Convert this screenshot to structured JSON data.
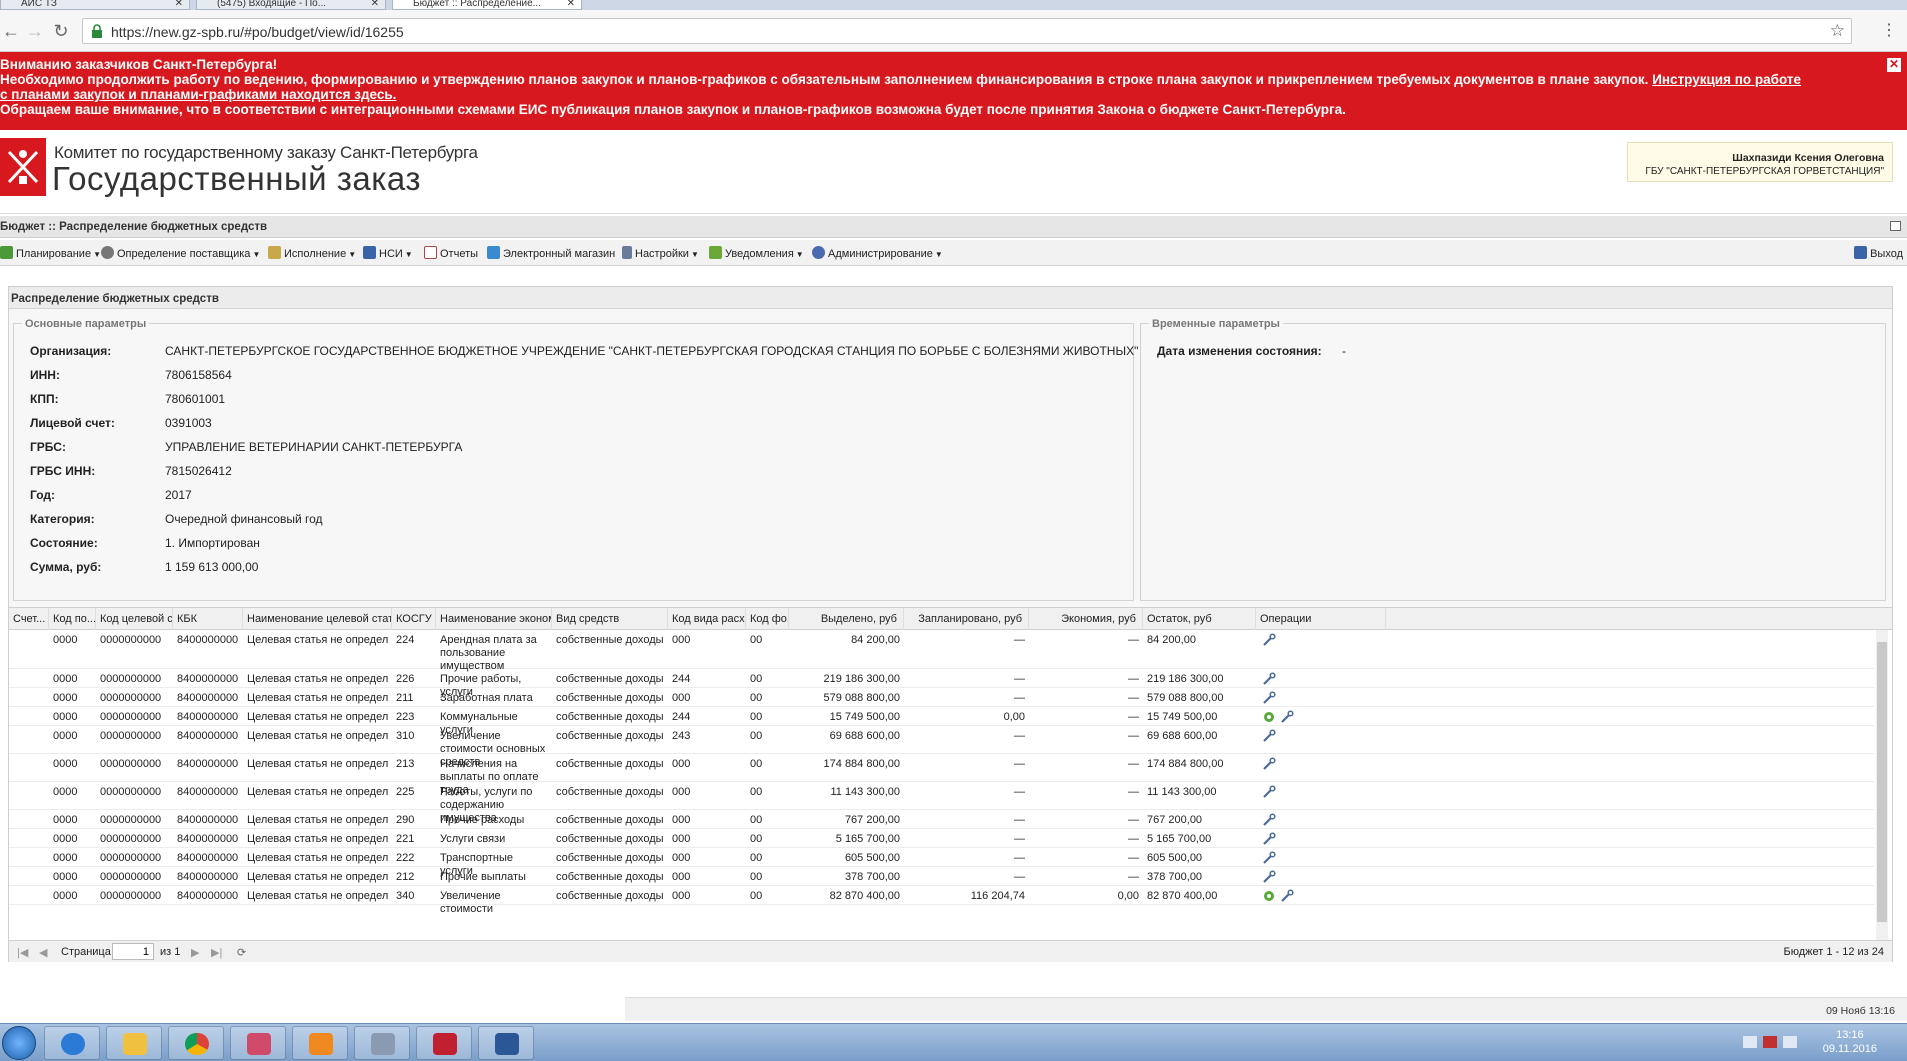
{
  "browser": {
    "tabs": [
      {
        "label": "АИС ТЗ",
        "active": false
      },
      {
        "label": "(5475) Входящие - По...",
        "active": false
      },
      {
        "label": "Бюджет :: Распределение...",
        "active": true
      }
    ],
    "url": "https://new.gz-spb.ru/#po/budget/view/id/16255"
  },
  "banner": {
    "line1": "Вниманию заказчиков Санкт-Петербурга!",
    "line2": "Необходимо продолжить работу по ведению, формированию и утверждению планов закупок и планов-графиков с обязательным заполнением финансирования в строке плана закупок и прикреплением требуемых документов в плане закупок.",
    "link_part1": "Инструкция по работе",
    "link_part2": "с планами закупок и планами-графиками находится здесь.",
    "line3": "Обращаем ваше внимание, что в соответствии с интеграционными схемами ЕИС публикация планов закупок и планов-графиков возможна будет после принятия Закона о бюджете Санкт-Петербурга.",
    "close": "✕"
  },
  "header": {
    "org_line": "Комитет по государственному заказу Санкт-Петербурга",
    "org_big": "Государственный заказ",
    "user_name": "Шахпазиди Ксения Олеговна",
    "user_org": "ГБУ \"САНКТ-ПЕТЕРБУРГСКАЯ ГОРВЕТСТАНЦИЯ\""
  },
  "breadcrumb": "Бюджет :: Распределение бюджетных средств",
  "menu": {
    "items": [
      {
        "label": "Планирование",
        "color": "#4a9a3a"
      },
      {
        "label": "Определение поставщика",
        "color": "#777777"
      },
      {
        "label": "Исполнение",
        "color": "#c9a84a"
      },
      {
        "label": "НСИ",
        "color": "#3a64a8"
      },
      {
        "label": "Отчеты",
        "color": "#a84a4a"
      },
      {
        "label": "Электронный магазин",
        "color": "#3a8ad0"
      },
      {
        "label": "Настройки",
        "color": "#6a7a9a"
      },
      {
        "label": "Уведомления",
        "color": "#6aa83a"
      },
      {
        "label": "Администрирование",
        "color": "#4a6ab0"
      }
    ],
    "exit": "Выход"
  },
  "panel": {
    "title": "Распределение бюджетных средств",
    "main_legend": "Основные параметры",
    "temp_legend": "Временные параметры",
    "fields": [
      {
        "label": "Организация:",
        "value": "САНКТ-ПЕТЕРБУРГСКОЕ ГОСУДАРСТВЕННОЕ БЮДЖЕТНОЕ УЧРЕЖДЕНИЕ \"САНКТ-ПЕТЕРБУРГСКАЯ ГОРОДСКАЯ СТАНЦИЯ ПО БОРЬБЕ С БОЛЕЗНЯМИ ЖИВОТНЫХ\""
      },
      {
        "label": "ИНН:",
        "value": "7806158564"
      },
      {
        "label": "КПП:",
        "value": "780601001"
      },
      {
        "label": "Лицевой счет:",
        "value": "0391003"
      },
      {
        "label": "ГРБС:",
        "value": "УПРАВЛЕНИЕ ВЕТЕРИНАРИИ САНКТ-ПЕТЕРБУРГА"
      },
      {
        "label": "ГРБС ИНН:",
        "value": "7815026412"
      },
      {
        "label": "Год:",
        "value": "2017"
      },
      {
        "label": "Категория:",
        "value": "Очередной финансовый год"
      },
      {
        "label": "Состояние:",
        "value": "1. Импортирован"
      },
      {
        "label": "Сумма, руб:",
        "value": "1 159 613 000,00"
      }
    ],
    "temp_field": {
      "label": "Дата изменения состояния:",
      "value": "-"
    }
  },
  "grid": {
    "columns": [
      "Счет...",
      "Код по...",
      "Код целевой с...",
      "КБК",
      "Наименование целевой статьи",
      "КОСГУ",
      "Наименование эконом...",
      "Вид средств",
      "Код вида расх...",
      "Код фо...",
      "Выделено, руб",
      "Запланировано, руб",
      "Экономия, руб",
      "Остаток, руб",
      "Операции"
    ],
    "rows": [
      {
        "kod_po": "0000",
        "kod_cel": "0000000000",
        "kbk": "8400000000...",
        "cel_name": "Целевая статья не определена",
        "kosgu": "224",
        "econ": "Арендная плата за пользование имуществом",
        "vid": "собственные доходы",
        "kvr": "000",
        "kfo": "00",
        "vydeleno": "84 200,00",
        "plan": "—",
        "econom": "—",
        "ostatok": "84 200,00",
        "ops": 1,
        "h": 39
      },
      {
        "kod_po": "0000",
        "kod_cel": "0000000000",
        "kbk": "8400000000...",
        "cel_name": "Целевая статья не определена",
        "kosgu": "226",
        "econ": "Прочие работы, услуги",
        "vid": "собственные доходы",
        "kvr": "244",
        "kfo": "00",
        "vydeleno": "219 186 300,00",
        "plan": "—",
        "econom": "—",
        "ostatok": "219 186 300,00",
        "ops": 1,
        "h": 19
      },
      {
        "kod_po": "0000",
        "kod_cel": "0000000000",
        "kbk": "8400000000...",
        "cel_name": "Целевая статья не определена",
        "kosgu": "211",
        "econ": "Заработная плата",
        "vid": "собственные доходы",
        "kvr": "000",
        "kfo": "00",
        "vydeleno": "579 088 800,00",
        "plan": "—",
        "econom": "—",
        "ostatok": "579 088 800,00",
        "ops": 1,
        "h": 19
      },
      {
        "kod_po": "0000",
        "kod_cel": "0000000000",
        "kbk": "8400000000...",
        "cel_name": "Целевая статья не определена",
        "kosgu": "223",
        "econ": "Коммунальные услуги",
        "vid": "собственные доходы",
        "kvr": "244",
        "kfo": "00",
        "vydeleno": "15 749 500,00",
        "plan": "0,00",
        "econom": "—",
        "ostatok": "15 749 500,00",
        "ops": 2,
        "h": 19
      },
      {
        "kod_po": "0000",
        "kod_cel": "0000000000",
        "kbk": "8400000000...",
        "cel_name": "Целевая статья не определена",
        "kosgu": "310",
        "econ": "Увеличение стоимости основных средств",
        "vid": "собственные доходы",
        "kvr": "243",
        "kfo": "00",
        "vydeleno": "69 688 600,00",
        "plan": "—",
        "econom": "—",
        "ostatok": "69 688 600,00",
        "ops": 1,
        "h": 28
      },
      {
        "kod_po": "0000",
        "kod_cel": "0000000000",
        "kbk": "8400000000...",
        "cel_name": "Целевая статья не определена",
        "kosgu": "213",
        "econ": "Начисления на выплаты по оплате труда",
        "vid": "собственные доходы",
        "kvr": "000",
        "kfo": "00",
        "vydeleno": "174 884 800,00",
        "plan": "—",
        "econom": "—",
        "ostatok": "174 884 800,00",
        "ops": 1,
        "h": 28
      },
      {
        "kod_po": "0000",
        "kod_cel": "0000000000",
        "kbk": "8400000000...",
        "cel_name": "Целевая статья не определена",
        "kosgu": "225",
        "econ": "Работы, услуги по содержанию имущества",
        "vid": "собственные доходы",
        "kvr": "000",
        "kfo": "00",
        "vydeleno": "11 143 300,00",
        "plan": "—",
        "econom": "—",
        "ostatok": "11 143 300,00",
        "ops": 1,
        "h": 28
      },
      {
        "kod_po": "0000",
        "kod_cel": "0000000000",
        "kbk": "8400000000...",
        "cel_name": "Целевая статья не определена",
        "kosgu": "290",
        "econ": "Прочие расходы",
        "vid": "собственные доходы",
        "kvr": "000",
        "kfo": "00",
        "vydeleno": "767 200,00",
        "plan": "—",
        "econom": "—",
        "ostatok": "767 200,00",
        "ops": 1,
        "h": 19
      },
      {
        "kod_po": "0000",
        "kod_cel": "0000000000",
        "kbk": "8400000000...",
        "cel_name": "Целевая статья не определена",
        "kosgu": "221",
        "econ": "Услуги связи",
        "vid": "собственные доходы",
        "kvr": "000",
        "kfo": "00",
        "vydeleno": "5 165 700,00",
        "plan": "—",
        "econom": "—",
        "ostatok": "5 165 700,00",
        "ops": 1,
        "h": 19
      },
      {
        "kod_po": "0000",
        "kod_cel": "0000000000",
        "kbk": "8400000000...",
        "cel_name": "Целевая статья не определена",
        "kosgu": "222",
        "econ": "Транспортные услуги",
        "vid": "собственные доходы",
        "kvr": "000",
        "kfo": "00",
        "vydeleno": "605 500,00",
        "plan": "—",
        "econom": "—",
        "ostatok": "605 500,00",
        "ops": 1,
        "h": 19
      },
      {
        "kod_po": "0000",
        "kod_cel": "0000000000",
        "kbk": "8400000000...",
        "cel_name": "Целевая статья не определена",
        "kosgu": "212",
        "econ": "Прочие выплаты",
        "vid": "собственные доходы",
        "kvr": "000",
        "kfo": "00",
        "vydeleno": "378 700,00",
        "plan": "—",
        "econom": "—",
        "ostatok": "378 700,00",
        "ops": 1,
        "h": 19
      },
      {
        "kod_po": "0000",
        "kod_cel": "0000000000",
        "kbk": "8400000000...",
        "cel_name": "Целевая статья не определена",
        "kosgu": "340",
        "econ": "Увеличение стоимости",
        "vid": "собственные доходы",
        "kvr": "000",
        "kfo": "00",
        "vydeleno": "82 870 400,00",
        "plan": "116 204,74",
        "econom": "0,00",
        "ostatok": "82 870 400,00",
        "ops": 2,
        "h": 19
      }
    ]
  },
  "pager": {
    "page_label": "Страница",
    "page_value": "1",
    "of_label": "из 1",
    "summary": "Бюджет 1 - 12 из 24"
  },
  "footer_date": "09 Нояб 13:16",
  "taskbar": {
    "time": "13:16",
    "date": "09.11.2016"
  }
}
